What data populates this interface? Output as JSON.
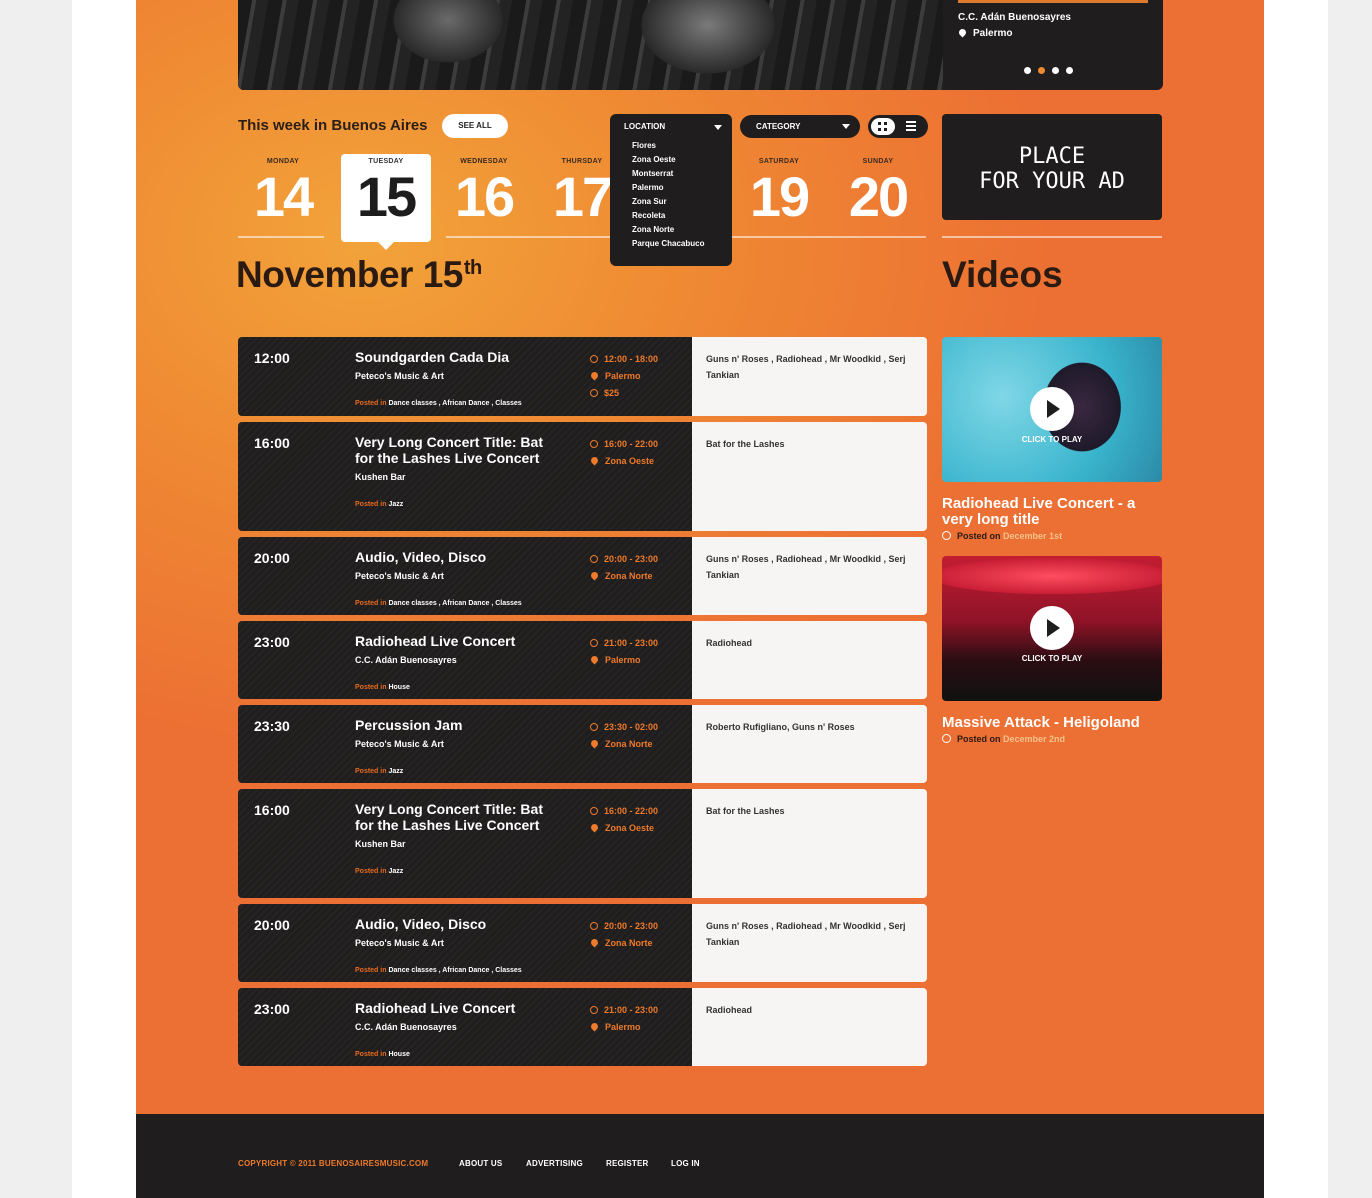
{
  "hero": {
    "venue": "C.C. Adán Buenosayres",
    "location": "Palermo",
    "dots": [
      false,
      true,
      false,
      false
    ]
  },
  "week": {
    "title": "This week in Buenos Aires",
    "see_all": "SEE ALL",
    "days": [
      {
        "name": "MONDAY",
        "num": "14"
      },
      {
        "name": "TUESDAY",
        "num": "15"
      },
      {
        "name": "WEDNESDAY",
        "num": "16"
      },
      {
        "name": "THURSDAY",
        "num": "17"
      },
      {
        "name": "SATURDAY",
        "num": "19"
      },
      {
        "name": "SUNDAY",
        "num": "20"
      }
    ]
  },
  "date_heading": {
    "text": "November 15",
    "suffix": "th"
  },
  "location_dropdown": {
    "label": "LOCATION",
    "options": [
      "Flores",
      "Zona Oeste",
      "Montserrat",
      "Palermo",
      "Zona Sur",
      "Recoleta",
      "Zona Norte",
      "Parque Chacabuco"
    ]
  },
  "category_dropdown": {
    "label": "CATEGORY"
  },
  "ad": {
    "line1": "PLACE",
    "line2": "FOR YOUR AD"
  },
  "videos_title": "Videos",
  "posted_in": "Posted in",
  "posted_on": "Posted on",
  "click_to_play": "CLICK TO PLAY",
  "events": [
    {
      "time": "12:00",
      "title": "Soundgarden Cada Dia",
      "venue": "Peteco's Music & Art",
      "tags": "Dance classes , African Dance , Classes",
      "hours": "12:00 - 18:00",
      "area": "Palermo",
      "price": "$25",
      "artists": "Guns n' Roses , Radiohead , Mr Woodkid , Serj Tankian"
    },
    {
      "time": "16:00",
      "title": "Very Long Concert Title: Bat for the Lashes Live Concert",
      "venue": "Kushen Bar",
      "tags": "Jazz",
      "hours": "16:00 - 22:00",
      "area": "Zona Oeste",
      "artists": "Bat for the Lashes"
    },
    {
      "time": "20:00",
      "title": "Audio, Video, Disco",
      "venue": "Peteco's Music & Art",
      "tags": "Dance classes , African Dance , Classes",
      "hours": "20:00 - 23:00",
      "area": "Zona Norte",
      "artists": "Guns n' Roses , Radiohead , Mr Woodkid , Serj Tankian"
    },
    {
      "time": "23:00",
      "title": "Radiohead Live Concert",
      "venue": "C.C. Adán Buenosayres",
      "tags": "House",
      "hours": "21:00 - 23:00",
      "area": "Palermo",
      "artists": "Radiohead"
    },
    {
      "time": "23:30",
      "title": "Percussion Jam",
      "venue": "Peteco's Music & Art",
      "tags": "Jazz",
      "hours": "23:30 - 02:00",
      "area": "Zona Norte",
      "artists": "Roberto Rufigliano, Guns n' Roses"
    },
    {
      "time": "16:00",
      "title": "Very Long Concert Title: Bat for the Lashes Live Concert",
      "venue": "Kushen Bar",
      "tags": "Jazz",
      "hours": "16:00 - 22:00",
      "area": "Zona Oeste",
      "artists": "Bat for the Lashes"
    },
    {
      "time": "20:00",
      "title": "Audio, Video, Disco",
      "venue": "Peteco's Music & Art",
      "tags": "Dance classes , African Dance , Classes",
      "hours": "20:00 - 23:00",
      "area": "Zona Norte",
      "artists": "Guns n' Roses , Radiohead , Mr Woodkid , Serj Tankian"
    },
    {
      "time": "23:00",
      "title": "Radiohead Live Concert",
      "venue": "C.C. Adán Buenosayres",
      "tags": "House",
      "hours": "21:00 - 23:00",
      "area": "Palermo",
      "artists": "Radiohead"
    }
  ],
  "videos": [
    {
      "title": "Radiohead Live Concert - a very long title",
      "date": "December 1st"
    },
    {
      "title": "Massive Attack - Heligoland",
      "date": "December 2nd"
    }
  ],
  "footer": {
    "copyright": "COPYRIGHT © 2011 BUENOSAIRESMUSIC.COM",
    "links": [
      "ABOUT US",
      "ADVERTISING",
      "REGISTER",
      "LOG IN"
    ]
  }
}
